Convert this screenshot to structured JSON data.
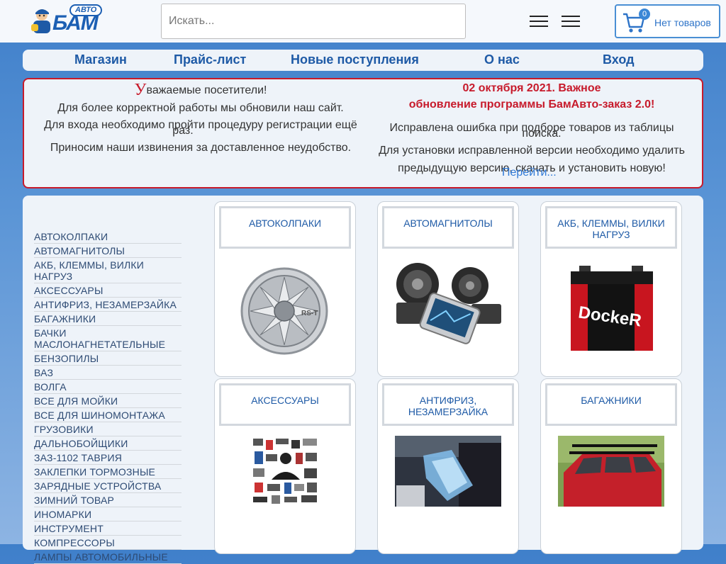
{
  "header": {
    "logo_text": "БАМ",
    "logo_sub": "АВТО",
    "search_placeholder": "Искать...",
    "cart_count": "0",
    "cart_label": "Нет товаров"
  },
  "nav": [
    "Магазин",
    "Прайс-лист",
    "Новые поступления",
    "О нас",
    "Вход"
  ],
  "notice": {
    "left_u": "У",
    "left_title_rest": "важаемые посетители!",
    "left_line1": "Для более корректной работы мы обновили наш сайт.",
    "left_line2": "Для входа необходимо пройти процедуру регистрации ещё",
    "left_line2b": "раз.",
    "left_line3": "Приносим наши извинения за доставленное неудобство.",
    "right_title1": "02 октября 2021. Важное",
    "right_title2": "обновление программы БамАвто-заказ 2.0!",
    "right_line1": "Исправлена ошибка при подборе товаров из таблицы",
    "right_line1b": "поиска.",
    "right_line2": "Для установки исправленной версии необходимо удалить",
    "right_line3": "предыдущую версию, скачать и установить новую!",
    "link": "Перейти..."
  },
  "categories": [
    "АВТОКОЛПАКИ",
    "АВТОМАГНИТОЛЫ",
    "АКБ, КЛЕММЫ, ВИЛКИ НАГРУЗ",
    "АКСЕССУАРЫ",
    "АНТИФРИЗ, НЕЗАМЕРЗАЙКА",
    "БАГАЖНИКИ",
    "БАЧКИ МАСЛОНАГНЕТАТЕЛЬНЫЕ",
    "БЕНЗОПИЛЫ",
    "ВАЗ",
    "ВОЛГА",
    "ВСЕ ДЛЯ МОЙКИ",
    "ВСЕ ДЛЯ ШИНОМОНТАЖА",
    "ГРУЗОВИКИ",
    "ДАЛЬНОБОЙЩИКИ",
    "ЗАЗ-1102 ТАВРИЯ",
    "ЗАКЛЕПКИ ТОРМОЗНЫЕ",
    "ЗАРЯДНЫЕ УСТРОЙСТВА",
    "ЗИМНИЙ ТОВАР",
    "ИНОМАРКИ",
    "ИНСТРУМЕНТ",
    "КОМПРЕССОРЫ",
    "ЛАМПЫ АВТОМОБИЛЬНЫЕ"
  ],
  "cards": [
    {
      "title": "АВТОКОЛПАКИ",
      "image_text": "RS-T"
    },
    {
      "title": "АВТОМАГНИТОЛЫ"
    },
    {
      "title": "АКБ, КЛЕММЫ, ВИЛКИ НАГРУЗ",
      "image_text": "DockeR"
    },
    {
      "title": "АКСЕССУАРЫ"
    },
    {
      "title": "АНТИФРИЗ, НЕЗАМЕРЗАЙКА"
    },
    {
      "title": "БАГАЖНИКИ"
    }
  ],
  "colors": {
    "brand_blue": "#1e5aa6",
    "notice_red": "#c71a2b",
    "cart_border": "#4a8fd4"
  }
}
